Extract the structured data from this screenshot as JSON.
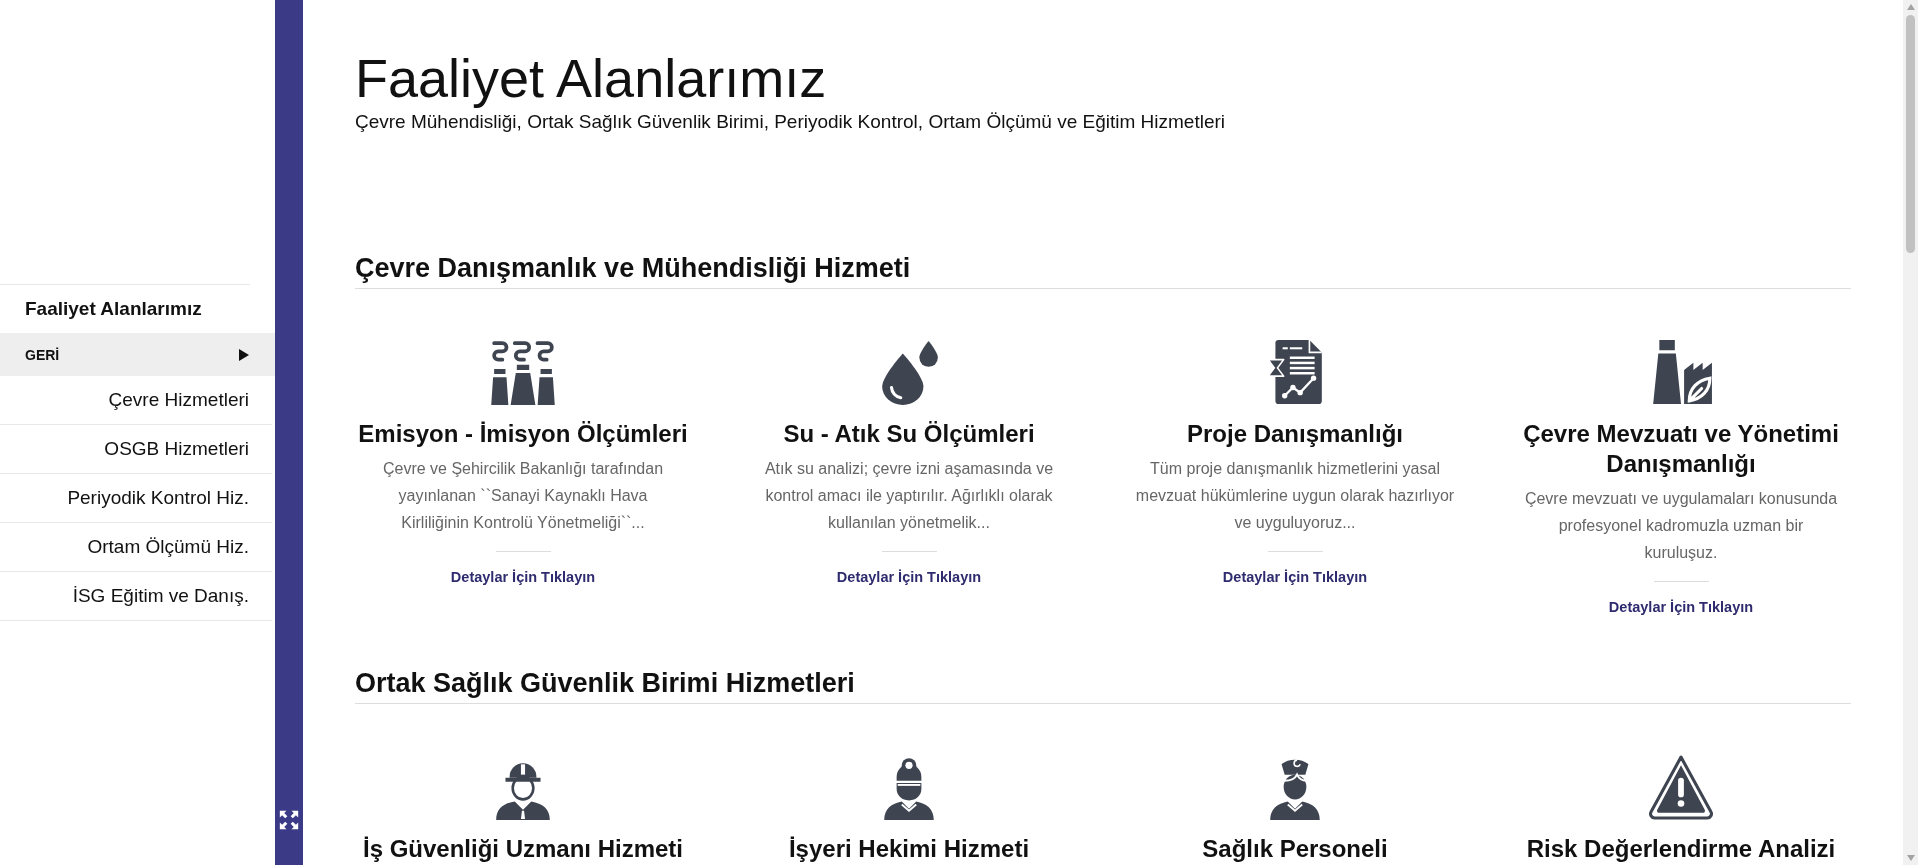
{
  "page": {
    "title": "Faaliyet Alanlarımız",
    "subtitle": "Çevre Mühendisliği, Ortak Sağlık Güvenlik Birimi, Periyodik Kontrol, Ortam Ölçümü ve Eğitim Hizmetleri"
  },
  "sidebar": {
    "title": "Faaliyet Alanlarımız",
    "back": "GERİ",
    "items": [
      "Çevre Hizmetleri",
      "OSGB Hizmetleri",
      "Periyodik Kontrol Hiz.",
      "Ortam Ölçümü Hiz.",
      "İSG Eğitim ve Danış."
    ]
  },
  "sections": [
    {
      "heading": "Çevre Danışmanlık ve Mühendisliği Hizmeti",
      "cards": [
        {
          "title": "Emisyon - İmisyon Ölçümleri",
          "description": "Çevre ve Şehircilik Bakanlığı tarafından yayınlanan ``Sanayi Kaynaklı Hava Kirliliğinin Kontrolü Yönetmeliği``...",
          "link": "Detaylar İçin Tıklayın"
        },
        {
          "title": "Su - Atık Su Ölçümleri",
          "description": "Atık su analizi; çevre izni aşamasında ve kontrol amacı ile yaptırılır. Ağırlıklı olarak kullanılan yönetmelik...",
          "link": "Detaylar İçin Tıklayın"
        },
        {
          "title": "Proje Danışmanlığı",
          "description": "Tüm proje danışmanlık hizmetlerini yasal mevzuat hükümlerine uygun olarak hazırlıyor ve uyguluyoruz...",
          "link": "Detaylar İçin Tıklayın"
        },
        {
          "title": "Çevre Mevzuatı ve Yönetimi Danışmanlığı",
          "description": "Çevre mevzuatı ve uygulamaları konusunda profesyonel kadromuzla uzman bir kuruluşuz.",
          "link": "Detaylar İçin Tıklayın"
        }
      ]
    },
    {
      "heading": "Ortak Sağlık Güvenlik Birimi Hizmetleri",
      "cards": [
        {
          "title": "İş Güvenliği Uzmanı Hizmeti"
        },
        {
          "title": "İşyeri Hekimi Hizmeti"
        },
        {
          "title": "Sağlık Personeli"
        },
        {
          "title": "Risk Değerlendirme Analizi"
        }
      ]
    }
  ]
}
